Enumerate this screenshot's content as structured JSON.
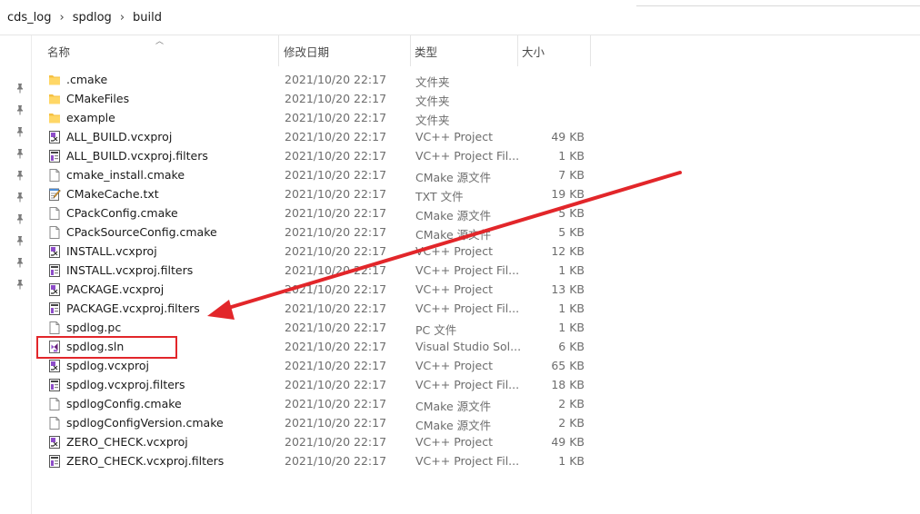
{
  "breadcrumb": [
    "cds_log",
    "spdlog",
    "build"
  ],
  "columns": {
    "name": "名称",
    "date": "修改日期",
    "type": "类型",
    "size": "大小"
  },
  "files": [
    {
      "name": ".cmake",
      "date": "2021/10/20 22:17",
      "type": "文件夹",
      "size": "",
      "icon": "folder-icon"
    },
    {
      "name": "CMakeFiles",
      "date": "2021/10/20 22:17",
      "type": "文件夹",
      "size": "",
      "icon": "folder-icon"
    },
    {
      "name": "example",
      "date": "2021/10/20 22:17",
      "type": "文件夹",
      "size": "",
      "icon": "folder-icon"
    },
    {
      "name": "ALL_BUILD.vcxproj",
      "date": "2021/10/20 22:17",
      "type": "VC++ Project",
      "size": "49 KB",
      "icon": "vcxproj-icon"
    },
    {
      "name": "ALL_BUILD.vcxproj.filters",
      "date": "2021/10/20 22:17",
      "type": "VC++ Project Fil...",
      "size": "1 KB",
      "icon": "filters-file-icon"
    },
    {
      "name": "cmake_install.cmake",
      "date": "2021/10/20 22:17",
      "type": "CMake 源文件",
      "size": "7 KB",
      "icon": "text-file-icon"
    },
    {
      "name": "CMakeCache.txt",
      "date": "2021/10/20 22:17",
      "type": "TXT 文件",
      "size": "19 KB",
      "icon": "notepad-file-icon"
    },
    {
      "name": "CPackConfig.cmake",
      "date": "2021/10/20 22:17",
      "type": "CMake 源文件",
      "size": "5 KB",
      "icon": "text-file-icon"
    },
    {
      "name": "CPackSourceConfig.cmake",
      "date": "2021/10/20 22:17",
      "type": "CMake 源文件",
      "size": "5 KB",
      "icon": "text-file-icon"
    },
    {
      "name": "INSTALL.vcxproj",
      "date": "2021/10/20 22:17",
      "type": "VC++ Project",
      "size": "12 KB",
      "icon": "vcxproj-icon"
    },
    {
      "name": "INSTALL.vcxproj.filters",
      "date": "2021/10/20 22:17",
      "type": "VC++ Project Fil...",
      "size": "1 KB",
      "icon": "filters-file-icon"
    },
    {
      "name": "PACKAGE.vcxproj",
      "date": "2021/10/20 22:17",
      "type": "VC++ Project",
      "size": "13 KB",
      "icon": "vcxproj-icon"
    },
    {
      "name": "PACKAGE.vcxproj.filters",
      "date": "2021/10/20 22:17",
      "type": "VC++ Project Fil...",
      "size": "1 KB",
      "icon": "filters-file-icon"
    },
    {
      "name": "spdlog.pc",
      "date": "2021/10/20 22:17",
      "type": "PC 文件",
      "size": "1 KB",
      "icon": "text-file-icon"
    },
    {
      "name": "spdlog.sln",
      "date": "2021/10/20 22:17",
      "type": "Visual Studio Sol...",
      "size": "6 KB",
      "icon": "visual-studio-sln-icon"
    },
    {
      "name": "spdlog.vcxproj",
      "date": "2021/10/20 22:17",
      "type": "VC++ Project",
      "size": "65 KB",
      "icon": "vcxproj-icon"
    },
    {
      "name": "spdlog.vcxproj.filters",
      "date": "2021/10/20 22:17",
      "type": "VC++ Project Fil...",
      "size": "18 KB",
      "icon": "filters-file-icon"
    },
    {
      "name": "spdlogConfig.cmake",
      "date": "2021/10/20 22:17",
      "type": "CMake 源文件",
      "size": "2 KB",
      "icon": "text-file-icon"
    },
    {
      "name": "spdlogConfigVersion.cmake",
      "date": "2021/10/20 22:17",
      "type": "CMake 源文件",
      "size": "2 KB",
      "icon": "text-file-icon"
    },
    {
      "name": "ZERO_CHECK.vcxproj",
      "date": "2021/10/20 22:17",
      "type": "VC++ Project",
      "size": "49 KB",
      "icon": "vcxproj-icon"
    },
    {
      "name": "ZERO_CHECK.vcxproj.filters",
      "date": "2021/10/20 22:17",
      "type": "VC++ Project Fil...",
      "size": "1 KB",
      "icon": "filters-file-icon"
    }
  ],
  "nav_pins": [
    "pin-icon",
    "pin-icon",
    "pin-icon",
    "pin-icon",
    "pin-icon",
    "pin-icon",
    "pin-icon",
    "pin-icon",
    "pin-icon",
    "pin-icon"
  ],
  "annotation": {
    "highlighted_file": "spdlog.sln",
    "color": "#e2262a"
  },
  "colors": {
    "folder": "#f5c042",
    "accent": "#e2262a",
    "vs_purple": "#8e4dc9"
  }
}
